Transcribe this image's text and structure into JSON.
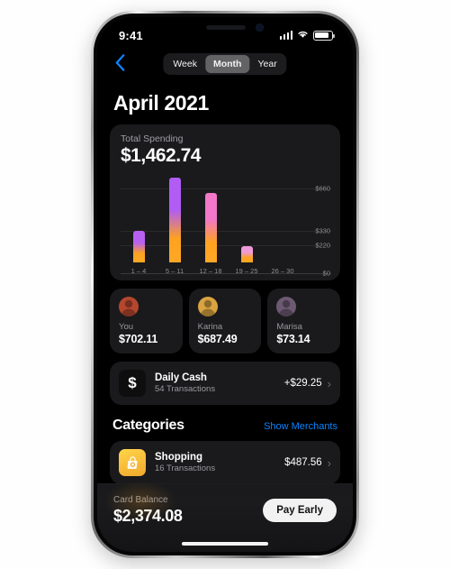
{
  "device": {
    "status_bar": {
      "time": "9:41",
      "cellular_icon": "signal-bars-icon",
      "wifi_icon": "wifi-icon",
      "battery_icon": "battery-icon"
    },
    "home_indicator": "home-indicator"
  },
  "nav": {
    "back_icon": "chevron-left-icon",
    "segments": [
      {
        "label": "Week",
        "active": false
      },
      {
        "label": "Month",
        "active": true
      },
      {
        "label": "Year",
        "active": false
      }
    ]
  },
  "page": {
    "title": "April 2021"
  },
  "spending": {
    "label": "Total Spending",
    "amount": "$1,462.74"
  },
  "chart_data": {
    "type": "bar",
    "title": "Total Spending",
    "categories": [
      "1 – 4",
      "5 – 11",
      "12 – 18",
      "19 – 25",
      "26 – 30"
    ],
    "values": [
      245,
      655,
      540,
      125,
      0
    ],
    "ytick_labels": [
      "$660",
      "$330",
      "$220",
      "$0"
    ],
    "ytick_positions": [
      660,
      330,
      220,
      0
    ],
    "ylim": [
      0,
      700
    ],
    "xlabel": "",
    "ylabel": "",
    "grid": true,
    "legend": "none",
    "bar_gradient_top": "#b05cf5",
    "bar_gradient_bottom": "#ffa826",
    "bar_tops": [
      "#b760f0",
      "#b05cf5",
      "#f277c8",
      "#f09ad8",
      "#ffa826"
    ]
  },
  "people": [
    {
      "name": "You",
      "amount": "$702.11",
      "avatar": "avatar-you-icon",
      "avatar_bg": "#b5472e"
    },
    {
      "name": "Karina",
      "amount": "$687.49",
      "avatar": "avatar-karina-icon",
      "avatar_bg": "#d9a441"
    },
    {
      "name": "Marisa",
      "amount": "$73.14",
      "avatar": "avatar-marisa-icon",
      "avatar_bg": "#6d5a72"
    }
  ],
  "daily_cash": {
    "icon": "dollar-sign-icon",
    "icon_glyph": "$",
    "title": "Daily Cash",
    "subtitle": "54 Transactions",
    "amount": "+$29.25",
    "chevron": "chevron-right-icon",
    "chevron_glyph": "›"
  },
  "categories_section": {
    "title": "Categories",
    "link_label": "Show Merchants",
    "link_color": "#0a84ff",
    "items": [
      {
        "icon": "shopping-bag-icon",
        "title": "Shopping",
        "subtitle": "16 Transactions",
        "amount": "$487.56",
        "chevron_glyph": "›"
      }
    ]
  },
  "card_balance": {
    "label": "Card Balance",
    "amount": "$2,374.08",
    "action_label": "Pay Early"
  }
}
